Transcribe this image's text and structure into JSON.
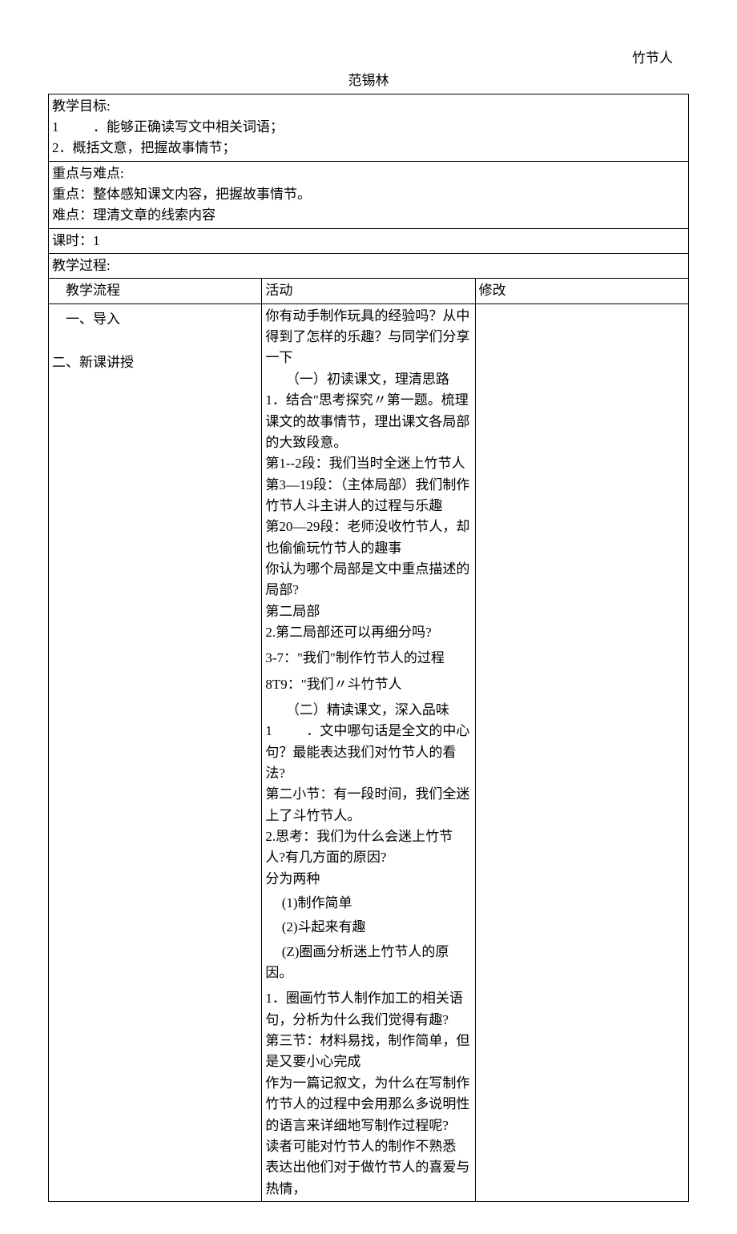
{
  "top_title": "竹节人",
  "author": "范锡林",
  "goals": {
    "label": "教学目标:",
    "item1_num": "1",
    "item1_text": "．能够正确读写文中相关词语；",
    "item2": "2．概括文意，把握故事情节；"
  },
  "keypoints": {
    "label": "重点与难点:",
    "key": "重点：整体感知课文内容，把握故事情节。",
    "diff": "难点：理清文章的线索内容"
  },
  "period": "课时：1",
  "process": {
    "label": "教学过程:",
    "header_flow": "教学流程",
    "header_activity": "活动",
    "header_modify": "修改",
    "col1_intro": "一、导入",
    "col1_new": "二、新课讲授",
    "activity": {
      "l1": "你有动手制作玩具的经验吗？从中得到了怎样的乐趣？与同学们分享一下",
      "l2": "（一）初读课文，理清思路",
      "l3": "1．结合\"思考探究〃第一题。梳理课文的故事情节，理出课文各局部的大致段意。",
      "l4": "第1--2段：我们当时全迷上竹节人",
      "l5": "第3—19段：（主体局部）我们制作竹节人斗主讲人的过程与乐趣",
      "l6": "第20—29段：老师没收竹节人，却也偷偷玩竹节人的趣事",
      "l7": "你认为哪个局部是文中重点描述的局部?",
      "l8": "第二局部",
      "l9": "2.第二局部还可以再细分吗?",
      "l10": "3-7：\"我们\"制作竹节人的过程",
      "l11": "8T9：\"我们〃斗竹节人",
      "l12": "（二）精读课文，深入品味",
      "l13_num": "1",
      "l13_text": "．文中哪句话是全文的中心句？最能表达我们对竹节人的看法?",
      "l14": "第二小节：有一段时间，我们全迷上了斗竹节人。",
      "l15": "2.思考：我们为什么会迷上竹节人?有几方面的原因?",
      "l16": "分为两种",
      "l17": "(1)制作简单",
      "l18": "(2)斗起来有趣",
      "l19": "(Z)圈画分析迷上竹节人的原因。",
      "l20": "1．圈画竹节人制作加工的相关语句，分析为什么我们觉得有趣?",
      "l21": "第三节：材料易找，制作简单，但是又要小心完成",
      "l22": "作为一篇记叙文，为什么在写制作竹节人的过程中会用那么多说明性的语言来详细地写制作过程呢?",
      "l23": "读者可能对竹节人的制作不熟悉",
      "l24": "表达出他们对于做竹节人的喜爱与热情，"
    }
  }
}
